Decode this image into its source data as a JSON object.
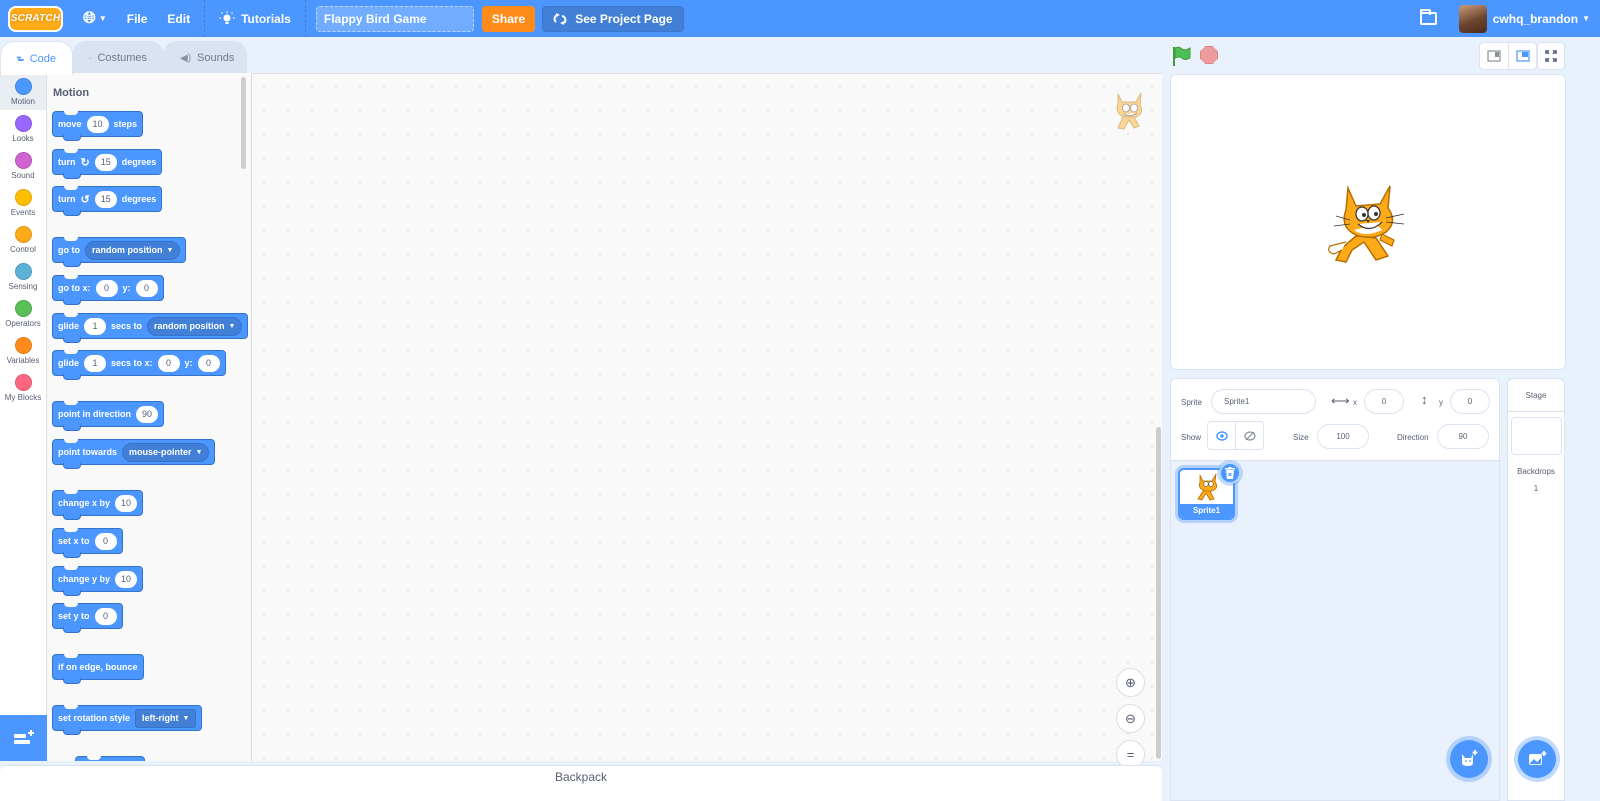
{
  "menubar": {
    "logo": "SCRATCH",
    "language_icon": "globe-icon",
    "file": "File",
    "edit": "Edit",
    "tutorials": "Tutorials",
    "project_title": "Flappy Bird Game",
    "share": "Share",
    "see_project_page": "See Project Page",
    "username": "cwhq_brandon"
  },
  "tabs": [
    {
      "label": "Code",
      "icon": "code-icon",
      "active": true
    },
    {
      "label": "Costumes",
      "icon": "brush-icon",
      "active": false
    },
    {
      "label": "Sounds",
      "icon": "speaker-icon",
      "active": false
    }
  ],
  "categories": [
    {
      "label": "Motion",
      "color": "#4c97ff",
      "active": true
    },
    {
      "label": "Looks",
      "color": "#9966ff"
    },
    {
      "label": "Sound",
      "color": "#cf63cf"
    },
    {
      "label": "Events",
      "color": "#ffbf00"
    },
    {
      "label": "Control",
      "color": "#ffab19"
    },
    {
      "label": "Sensing",
      "color": "#5cb1d6"
    },
    {
      "label": "Operators",
      "color": "#59c059"
    },
    {
      "label": "Variables",
      "color": "#ff8c1a"
    },
    {
      "label": "My Blocks",
      "color": "#ff6680"
    }
  ],
  "flyout": {
    "title": "Motion",
    "blocks": {
      "move": {
        "t1": "move",
        "v1": "10",
        "t2": "steps"
      },
      "turn_right": {
        "t1": "turn",
        "v1": "15",
        "t2": "degrees"
      },
      "turn_left": {
        "t1": "turn",
        "v1": "15",
        "t2": "degrees"
      },
      "goto": {
        "t1": "go to",
        "menu": "random position"
      },
      "goto_xy": {
        "t1": "go to x:",
        "v1": "0",
        "t2": "y:",
        "v2": "0"
      },
      "glide_to": {
        "t1": "glide",
        "v1": "1",
        "t2": "secs to",
        "menu": "random position"
      },
      "glide_xy": {
        "t1": "glide",
        "v1": "1",
        "t2": "secs to x:",
        "v2": "0",
        "t3": "y:",
        "v3": "0"
      },
      "point_dir": {
        "t1": "point in direction",
        "v1": "90"
      },
      "point_towards": {
        "t1": "point towards",
        "menu": "mouse-pointer"
      },
      "change_x": {
        "t1": "change x by",
        "v1": "10"
      },
      "set_x": {
        "t1": "set x to",
        "v1": "0"
      },
      "change_y": {
        "t1": "change y by",
        "v1": "10"
      },
      "set_y": {
        "t1": "set y to",
        "v1": "0"
      },
      "bounce": {
        "t1": "if on edge, bounce"
      },
      "rotation": {
        "t1": "set rotation style",
        "menu": "left-right"
      }
    }
  },
  "workspace": {
    "backpack": "Backpack"
  },
  "sprite_info": {
    "sprite_label": "Sprite",
    "sprite_name": "Sprite1",
    "x_label": "x",
    "x_value": "0",
    "y_label": "y",
    "y_value": "0",
    "show_label": "Show",
    "size_label": "Size",
    "size_value": "100",
    "direction_label": "Direction",
    "direction_value": "90"
  },
  "sprites": [
    {
      "name": "Sprite1",
      "selected": true
    }
  ],
  "stage_selector": {
    "title": "Stage",
    "backdrops_label": "Backdrops",
    "backdrops_count": "1"
  }
}
